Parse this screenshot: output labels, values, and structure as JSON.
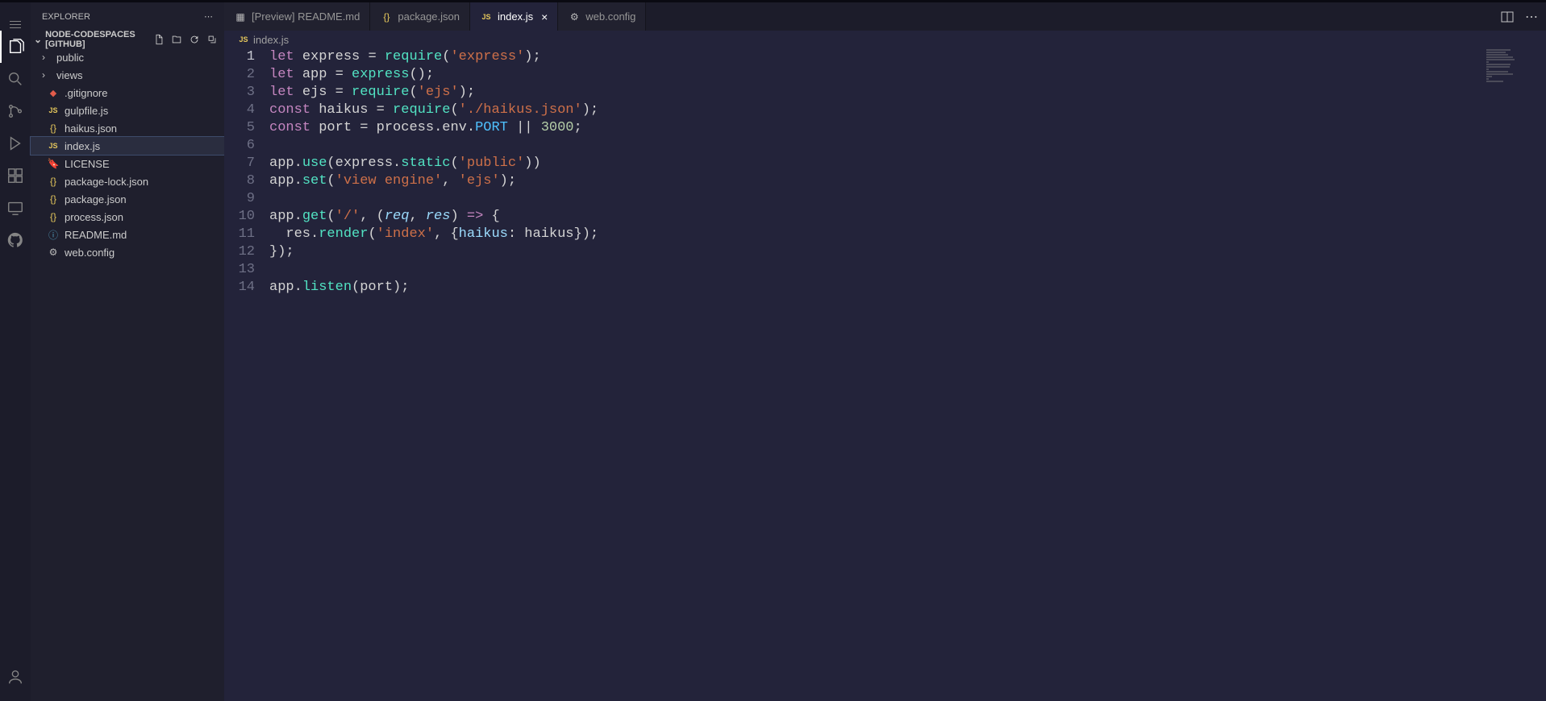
{
  "sidebar_title": "EXPLORER",
  "workspace_name": "NODE-CODESPACES [GITHUB]",
  "activity_items": [
    "explorer",
    "search",
    "source-control",
    "run",
    "extensions",
    "remote",
    "github"
  ],
  "files": {
    "folders": [
      {
        "name": "public"
      },
      {
        "name": "views"
      }
    ],
    "items": [
      {
        "name": ".gitignore",
        "icon": "git"
      },
      {
        "name": "gulpfile.js",
        "icon": "js"
      },
      {
        "name": "haikus.json",
        "icon": "json"
      },
      {
        "name": "index.js",
        "icon": "js",
        "selected": true
      },
      {
        "name": "LICENSE",
        "icon": "lic"
      },
      {
        "name": "package-lock.json",
        "icon": "json"
      },
      {
        "name": "package.json",
        "icon": "json"
      },
      {
        "name": "process.json",
        "icon": "json"
      },
      {
        "name": "README.md",
        "icon": "md"
      },
      {
        "name": "web.config",
        "icon": "gear"
      }
    ]
  },
  "tabs": [
    {
      "label": "[Preview] README.md",
      "icon": "preview",
      "active": false
    },
    {
      "label": "package.json",
      "icon": "json",
      "active": false
    },
    {
      "label": "index.js",
      "icon": "js",
      "active": true
    },
    {
      "label": "web.config",
      "icon": "gear",
      "active": false
    }
  ],
  "breadcrumb_icon": "js",
  "breadcrumb_label": "index.js",
  "active_line": 1,
  "code_lines": [
    [
      {
        "t": "kw",
        "v": "let"
      },
      {
        "t": "sp",
        "v": " "
      },
      {
        "t": "var",
        "v": "express"
      },
      {
        "t": "sp",
        "v": " "
      },
      {
        "t": "op",
        "v": "="
      },
      {
        "t": "sp",
        "v": " "
      },
      {
        "t": "fn",
        "v": "require"
      },
      {
        "t": "op",
        "v": "("
      },
      {
        "t": "str",
        "v": "'express'"
      },
      {
        "t": "op",
        "v": ");"
      }
    ],
    [
      {
        "t": "kw",
        "v": "let"
      },
      {
        "t": "sp",
        "v": " "
      },
      {
        "t": "var",
        "v": "app"
      },
      {
        "t": "sp",
        "v": " "
      },
      {
        "t": "op",
        "v": "="
      },
      {
        "t": "sp",
        "v": " "
      },
      {
        "t": "fn",
        "v": "express"
      },
      {
        "t": "op",
        "v": "();"
      }
    ],
    [
      {
        "t": "kw",
        "v": "let"
      },
      {
        "t": "sp",
        "v": " "
      },
      {
        "t": "var",
        "v": "ejs"
      },
      {
        "t": "sp",
        "v": " "
      },
      {
        "t": "op",
        "v": "="
      },
      {
        "t": "sp",
        "v": " "
      },
      {
        "t": "fn",
        "v": "require"
      },
      {
        "t": "op",
        "v": "("
      },
      {
        "t": "str",
        "v": "'ejs'"
      },
      {
        "t": "op",
        "v": ");"
      }
    ],
    [
      {
        "t": "kw",
        "v": "const"
      },
      {
        "t": "sp",
        "v": " "
      },
      {
        "t": "var",
        "v": "haikus"
      },
      {
        "t": "sp",
        "v": " "
      },
      {
        "t": "op",
        "v": "="
      },
      {
        "t": "sp",
        "v": " "
      },
      {
        "t": "fn",
        "v": "require"
      },
      {
        "t": "op",
        "v": "("
      },
      {
        "t": "str",
        "v": "'./haikus.json'"
      },
      {
        "t": "op",
        "v": ");"
      }
    ],
    [
      {
        "t": "kw",
        "v": "const"
      },
      {
        "t": "sp",
        "v": " "
      },
      {
        "t": "var",
        "v": "port"
      },
      {
        "t": "sp",
        "v": " "
      },
      {
        "t": "op",
        "v": "="
      },
      {
        "t": "sp",
        "v": " "
      },
      {
        "t": "var",
        "v": "process"
      },
      {
        "t": "op",
        "v": "."
      },
      {
        "t": "var",
        "v": "env"
      },
      {
        "t": "op",
        "v": "."
      },
      {
        "t": "env",
        "v": "PORT"
      },
      {
        "t": "sp",
        "v": " "
      },
      {
        "t": "op",
        "v": "||"
      },
      {
        "t": "sp",
        "v": " "
      },
      {
        "t": "num",
        "v": "3000"
      },
      {
        "t": "op",
        "v": ";"
      }
    ],
    [],
    [
      {
        "t": "var",
        "v": "app"
      },
      {
        "t": "op",
        "v": "."
      },
      {
        "t": "fn",
        "v": "use"
      },
      {
        "t": "op",
        "v": "("
      },
      {
        "t": "var",
        "v": "express"
      },
      {
        "t": "op",
        "v": "."
      },
      {
        "t": "fn",
        "v": "static"
      },
      {
        "t": "op",
        "v": "("
      },
      {
        "t": "str",
        "v": "'public'"
      },
      {
        "t": "op",
        "v": "))"
      }
    ],
    [
      {
        "t": "var",
        "v": "app"
      },
      {
        "t": "op",
        "v": "."
      },
      {
        "t": "fn",
        "v": "set"
      },
      {
        "t": "op",
        "v": "("
      },
      {
        "t": "str",
        "v": "'view engine'"
      },
      {
        "t": "op",
        "v": ", "
      },
      {
        "t": "str",
        "v": "'ejs'"
      },
      {
        "t": "op",
        "v": ");"
      }
    ],
    [],
    [
      {
        "t": "var",
        "v": "app"
      },
      {
        "t": "op",
        "v": "."
      },
      {
        "t": "fn",
        "v": "get"
      },
      {
        "t": "op",
        "v": "("
      },
      {
        "t": "str",
        "v": "'/'"
      },
      {
        "t": "op",
        "v": ", ("
      },
      {
        "t": "param",
        "v": "req"
      },
      {
        "t": "op",
        "v": ", "
      },
      {
        "t": "param",
        "v": "res"
      },
      {
        "t": "op",
        "v": ") "
      },
      {
        "t": "kw",
        "v": "=>"
      },
      {
        "t": "op",
        "v": " {"
      }
    ],
    [
      {
        "t": "sp",
        "v": "  "
      },
      {
        "t": "var",
        "v": "res"
      },
      {
        "t": "op",
        "v": "."
      },
      {
        "t": "fn",
        "v": "render"
      },
      {
        "t": "op",
        "v": "("
      },
      {
        "t": "str",
        "v": "'index'"
      },
      {
        "t": "op",
        "v": ", {"
      },
      {
        "t": "prop",
        "v": "haikus"
      },
      {
        "t": "op",
        "v": ": "
      },
      {
        "t": "var",
        "v": "haikus"
      },
      {
        "t": "op",
        "v": "});"
      }
    ],
    [
      {
        "t": "op",
        "v": "});"
      }
    ],
    [],
    [
      {
        "t": "var",
        "v": "app"
      },
      {
        "t": "op",
        "v": "."
      },
      {
        "t": "fn",
        "v": "listen"
      },
      {
        "t": "op",
        "v": "("
      },
      {
        "t": "var",
        "v": "port"
      },
      {
        "t": "op",
        "v": ");"
      }
    ]
  ]
}
